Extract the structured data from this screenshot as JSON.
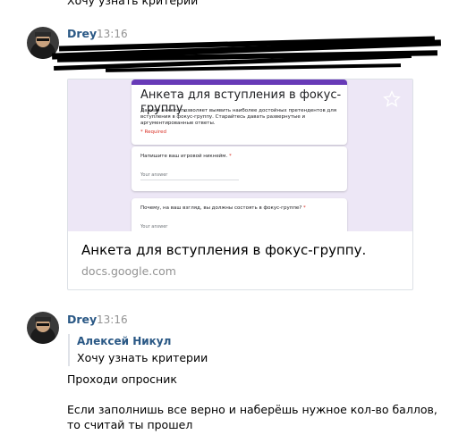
{
  "prev_message": {
    "text": "Хочу узнать критерии"
  },
  "message1": {
    "author": "Drey",
    "time": "13:16",
    "link_card": {
      "form_title": "Анкета для вступления в фокус-группу.",
      "form_description": "Данная анкета позволяет выявить наиболее достойных претендентов для вступления в фокус-группу. Старайтесь давать развернутые и аргументированные ответы.",
      "form_required": "* Required",
      "question1": "Напишите ваш игровой никнейм.",
      "question1_required": "*",
      "question1_placeholder": "Your answer",
      "question2": "Почему, на ваш взгляд, вы должны состоять в фокус-группе?",
      "question2_required": "*",
      "question2_placeholder": "Your answer",
      "title": "Анкета для вступления в фокус-группу.",
      "domain": "docs.google.com"
    }
  },
  "message2": {
    "author": "Drey",
    "time": "13:16",
    "reply": {
      "author": "Алексей Никул",
      "text": "Хочу узнать критерии"
    },
    "lines": [
      "Проходи опросник",
      "Если заполнишь все верно и наберёшь нужное кол-во баллов,",
      "то считай ты прошел"
    ]
  },
  "colors": {
    "author_link": "#2a5885",
    "form_accent": "#673ab7",
    "form_background": "#ede7f6"
  }
}
